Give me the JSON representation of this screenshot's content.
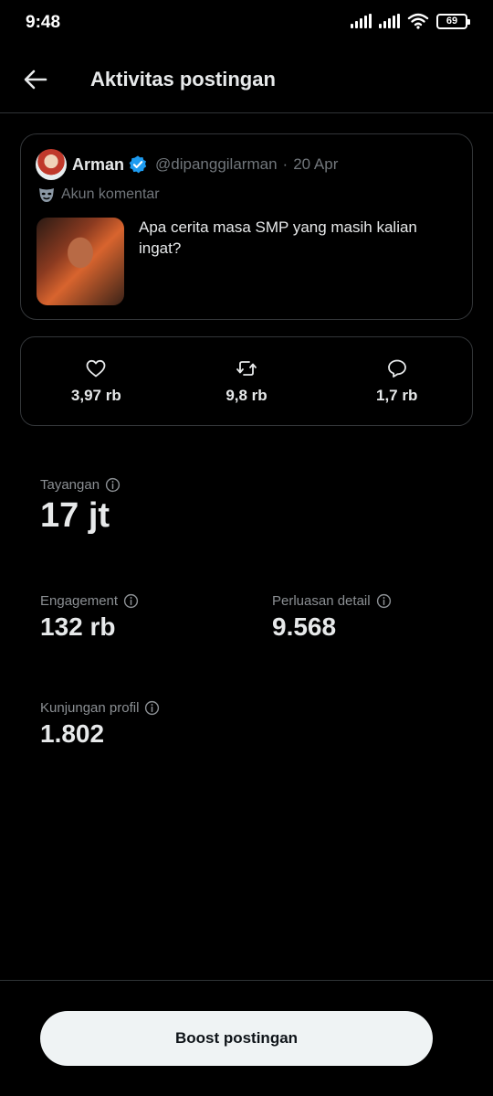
{
  "status_bar": {
    "time": "9:48",
    "battery": "69"
  },
  "header": {
    "title": "Aktivitas postingan",
    "back_icon": "arrow-left-icon"
  },
  "post": {
    "author": "Arman",
    "handle": "@dipanggilarman",
    "separator": "·",
    "date": "20 Apr",
    "account_note": "Akun komentar",
    "text": "Apa cerita masa SMP yang masih kalian ingat?",
    "verified_color": "#1d9bf0"
  },
  "stats": {
    "likes": "3,97 rb",
    "reposts": "9,8 rb",
    "replies": "1,7 rb"
  },
  "metrics": {
    "views": {
      "label": "Tayangan",
      "value": "17 jt"
    },
    "engagement": {
      "label": "Engagement",
      "value": "132 rb"
    },
    "expansion": {
      "label": "Perluasan detail",
      "value": "9.568"
    },
    "profile_visits": {
      "label": "Kunjungan profil",
      "value": "1.802"
    }
  },
  "footer": {
    "boost_label": "Boost postingan"
  },
  "colors": {
    "background": "#000000",
    "text_primary": "#e7e9ea",
    "text_secondary": "#71767b",
    "border": "#2f3336",
    "button_bg": "#eff3f4"
  }
}
